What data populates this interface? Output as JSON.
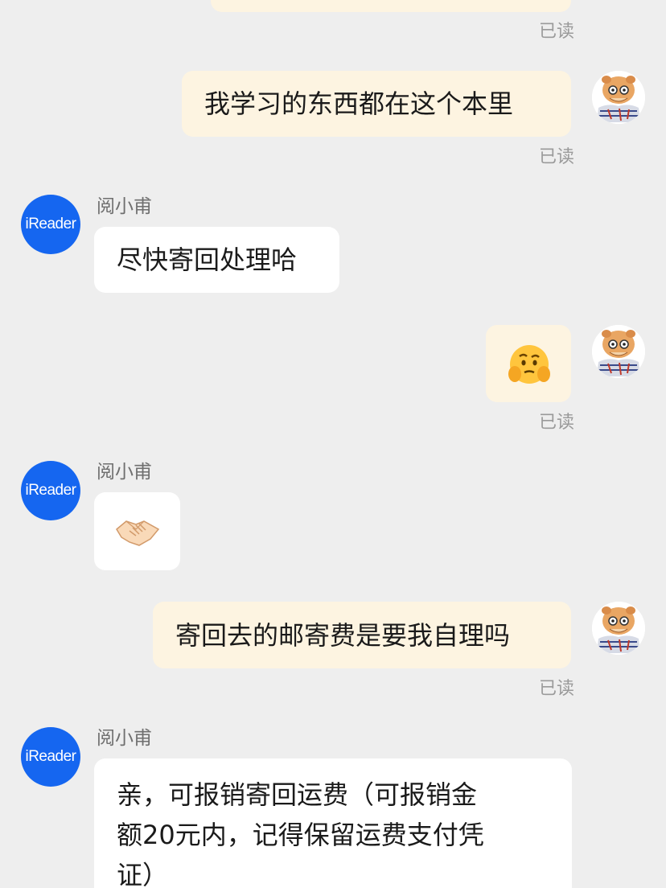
{
  "messages": [
    {
      "id": "m0",
      "side": "mine",
      "text": "",
      "read": "已读"
    },
    {
      "id": "m1",
      "side": "mine",
      "text": "我学习的东西都在这个本里",
      "read": "已读"
    },
    {
      "id": "m2",
      "side": "theirs",
      "sender": "阅小甫",
      "avatar_text": "iReader",
      "text": "尽快寄回处理哈"
    },
    {
      "id": "m3",
      "side": "mine",
      "emoji": "thinking-face-icon",
      "read": "已读"
    },
    {
      "id": "m4",
      "side": "theirs",
      "sender": "阅小甫",
      "avatar_text": "iReader",
      "emoji": "handshake-icon"
    },
    {
      "id": "m5",
      "side": "mine",
      "text": "寄回去的邮寄费是要我自理吗",
      "read": "已读"
    },
    {
      "id": "m6",
      "side": "theirs",
      "sender": "阅小甫",
      "avatar_text": "iReader",
      "lines": [
        "亲，可报销寄回运费（可报销金",
        "额20元内，记得保留运费支付凭",
        "证）"
      ]
    }
  ],
  "colors": {
    "background": "#eeeeee",
    "my_bubble": "#fdf4e1",
    "their_bubble": "#ffffff",
    "avatar_blue": "#1566f0",
    "read_label": "#9a9a9a",
    "sender_name": "#6f6f6f"
  }
}
